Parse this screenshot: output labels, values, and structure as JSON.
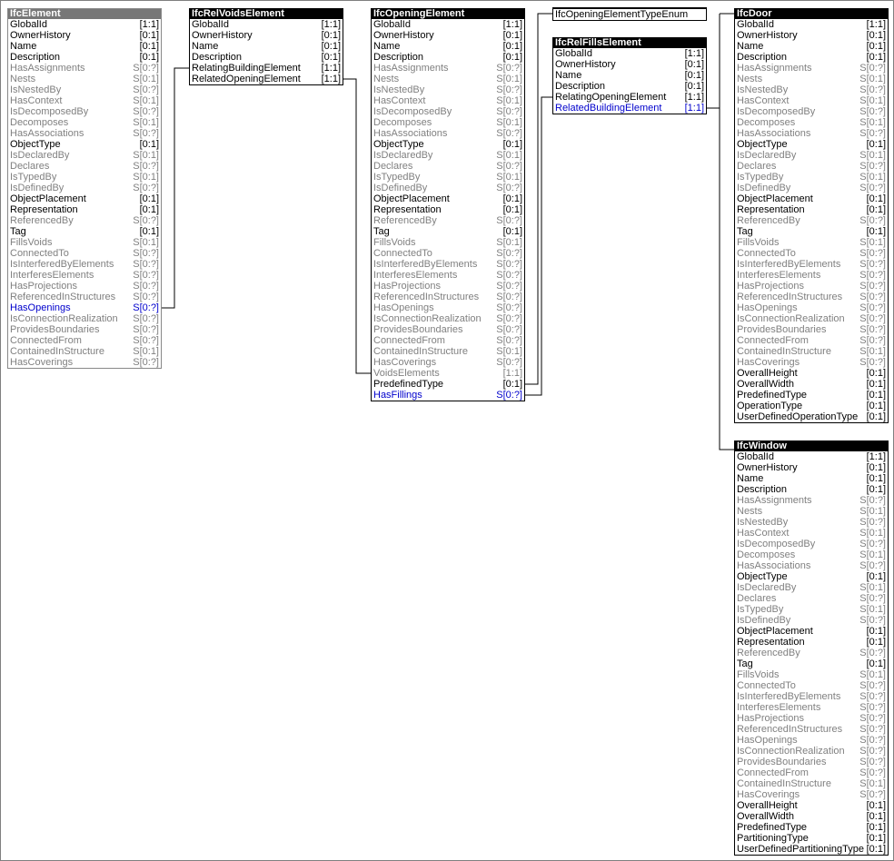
{
  "entities": [
    {
      "id": "IfcElement",
      "name": "IfcElement",
      "header": "gray",
      "rows": [
        [
          "GlobalId",
          "[1:1]",
          "n"
        ],
        [
          "OwnerHistory",
          "[0:1]",
          "n"
        ],
        [
          "Name",
          "[0:1]",
          "n"
        ],
        [
          "Description",
          "[0:1]",
          "n"
        ],
        [
          "HasAssignments",
          "S[0:?]",
          "i"
        ],
        [
          "Nests",
          "S[0:1]",
          "i"
        ],
        [
          "IsNestedBy",
          "S[0:?]",
          "i"
        ],
        [
          "HasContext",
          "S[0:1]",
          "i"
        ],
        [
          "IsDecomposedBy",
          "S[0:?]",
          "i"
        ],
        [
          "Decomposes",
          "S[0:1]",
          "i"
        ],
        [
          "HasAssociations",
          "S[0:?]",
          "i"
        ],
        [
          "ObjectType",
          "[0:1]",
          "n"
        ],
        [
          "IsDeclaredBy",
          "S[0:1]",
          "i"
        ],
        [
          "Declares",
          "S[0:?]",
          "i"
        ],
        [
          "IsTypedBy",
          "S[0:1]",
          "i"
        ],
        [
          "IsDefinedBy",
          "S[0:?]",
          "i"
        ],
        [
          "ObjectPlacement",
          "[0:1]",
          "n"
        ],
        [
          "Representation",
          "[0:1]",
          "n"
        ],
        [
          "ReferencedBy",
          "S[0:?]",
          "i"
        ],
        [
          "Tag",
          "[0:1]",
          "n"
        ],
        [
          "FillsVoids",
          "S[0:1]",
          "i"
        ],
        [
          "ConnectedTo",
          "S[0:?]",
          "i"
        ],
        [
          "IsInterferedByElements",
          "S[0:?]",
          "i"
        ],
        [
          "InterferesElements",
          "S[0:?]",
          "i"
        ],
        [
          "HasProjections",
          "S[0:?]",
          "i"
        ],
        [
          "ReferencedInStructures",
          "S[0:?]",
          "i"
        ],
        [
          "HasOpenings",
          "S[0:?]",
          "l"
        ],
        [
          "IsConnectionRealization",
          "S[0:?]",
          "i"
        ],
        [
          "ProvidesBoundaries",
          "S[0:?]",
          "i"
        ],
        [
          "ConnectedFrom",
          "S[0:?]",
          "i"
        ],
        [
          "ContainedInStructure",
          "S[0:1]",
          "i"
        ],
        [
          "HasCoverings",
          "S[0:?]",
          "i"
        ]
      ]
    },
    {
      "id": "IfcRelVoidsElement",
      "name": "IfcRelVoidsElement",
      "header": "black",
      "rows": [
        [
          "GlobalId",
          "[1:1]",
          "n"
        ],
        [
          "OwnerHistory",
          "[0:1]",
          "n"
        ],
        [
          "Name",
          "[0:1]",
          "n"
        ],
        [
          "Description",
          "[0:1]",
          "n"
        ],
        [
          "RelatingBuildingElement",
          "[1:1]",
          "n"
        ],
        [
          "RelatedOpeningElement",
          "[1:1]",
          "n"
        ]
      ]
    },
    {
      "id": "IfcOpeningElement",
      "name": "IfcOpeningElement",
      "header": "black",
      "rows": [
        [
          "GlobalId",
          "[1:1]",
          "n"
        ],
        [
          "OwnerHistory",
          "[0:1]",
          "n"
        ],
        [
          "Name",
          "[0:1]",
          "n"
        ],
        [
          "Description",
          "[0:1]",
          "n"
        ],
        [
          "HasAssignments",
          "S[0:?]",
          "i"
        ],
        [
          "Nests",
          "S[0:1]",
          "i"
        ],
        [
          "IsNestedBy",
          "S[0:?]",
          "i"
        ],
        [
          "HasContext",
          "S[0:1]",
          "i"
        ],
        [
          "IsDecomposedBy",
          "S[0:?]",
          "i"
        ],
        [
          "Decomposes",
          "S[0:1]",
          "i"
        ],
        [
          "HasAssociations",
          "S[0:?]",
          "i"
        ],
        [
          "ObjectType",
          "[0:1]",
          "n"
        ],
        [
          "IsDeclaredBy",
          "S[0:1]",
          "i"
        ],
        [
          "Declares",
          "S[0:?]",
          "i"
        ],
        [
          "IsTypedBy",
          "S[0:1]",
          "i"
        ],
        [
          "IsDefinedBy",
          "S[0:?]",
          "i"
        ],
        [
          "ObjectPlacement",
          "[0:1]",
          "n"
        ],
        [
          "Representation",
          "[0:1]",
          "n"
        ],
        [
          "ReferencedBy",
          "S[0:?]",
          "i"
        ],
        [
          "Tag",
          "[0:1]",
          "n"
        ],
        [
          "FillsVoids",
          "S[0:1]",
          "i"
        ],
        [
          "ConnectedTo",
          "S[0:?]",
          "i"
        ],
        [
          "IsInterferedByElements",
          "S[0:?]",
          "i"
        ],
        [
          "InterferesElements",
          "S[0:?]",
          "i"
        ],
        [
          "HasProjections",
          "S[0:?]",
          "i"
        ],
        [
          "ReferencedInStructures",
          "S[0:?]",
          "i"
        ],
        [
          "HasOpenings",
          "S[0:?]",
          "i"
        ],
        [
          "IsConnectionRealization",
          "S[0:?]",
          "i"
        ],
        [
          "ProvidesBoundaries",
          "S[0:?]",
          "i"
        ],
        [
          "ConnectedFrom",
          "S[0:?]",
          "i"
        ],
        [
          "ContainedInStructure",
          "S[0:1]",
          "i"
        ],
        [
          "HasCoverings",
          "S[0:?]",
          "i"
        ],
        [
          "VoidsElements",
          "[1:1]",
          "i"
        ],
        [
          "PredefinedType",
          "[0:1]",
          "n"
        ],
        [
          "HasFillings",
          "S[0:?]",
          "l"
        ]
      ]
    },
    {
      "id": "IfcRelFillsElement",
      "name": "IfcRelFillsElement",
      "header": "black",
      "rows": [
        [
          "GlobalId",
          "[1:1]",
          "n"
        ],
        [
          "OwnerHistory",
          "[0:1]",
          "n"
        ],
        [
          "Name",
          "[0:1]",
          "n"
        ],
        [
          "Description",
          "[0:1]",
          "n"
        ],
        [
          "RelatingOpeningElement",
          "[1:1]",
          "n"
        ],
        [
          "RelatedBuildingElement",
          "[1:1]",
          "l"
        ]
      ]
    },
    {
      "id": "IfcDoor",
      "name": "IfcDoor",
      "header": "black",
      "rows": [
        [
          "GlobalId",
          "[1:1]",
          "n"
        ],
        [
          "OwnerHistory",
          "[0:1]",
          "n"
        ],
        [
          "Name",
          "[0:1]",
          "n"
        ],
        [
          "Description",
          "[0:1]",
          "n"
        ],
        [
          "HasAssignments",
          "S[0:?]",
          "i"
        ],
        [
          "Nests",
          "S[0:1]",
          "i"
        ],
        [
          "IsNestedBy",
          "S[0:?]",
          "i"
        ],
        [
          "HasContext",
          "S[0:1]",
          "i"
        ],
        [
          "IsDecomposedBy",
          "S[0:?]",
          "i"
        ],
        [
          "Decomposes",
          "S[0:1]",
          "i"
        ],
        [
          "HasAssociations",
          "S[0:?]",
          "i"
        ],
        [
          "ObjectType",
          "[0:1]",
          "n"
        ],
        [
          "IsDeclaredBy",
          "S[0:1]",
          "i"
        ],
        [
          "Declares",
          "S[0:?]",
          "i"
        ],
        [
          "IsTypedBy",
          "S[0:1]",
          "i"
        ],
        [
          "IsDefinedBy",
          "S[0:?]",
          "i"
        ],
        [
          "ObjectPlacement",
          "[0:1]",
          "n"
        ],
        [
          "Representation",
          "[0:1]",
          "n"
        ],
        [
          "ReferencedBy",
          "S[0:?]",
          "i"
        ],
        [
          "Tag",
          "[0:1]",
          "n"
        ],
        [
          "FillsVoids",
          "S[0:1]",
          "i"
        ],
        [
          "ConnectedTo",
          "S[0:?]",
          "i"
        ],
        [
          "IsInterferedByElements",
          "S[0:?]",
          "i"
        ],
        [
          "InterferesElements",
          "S[0:?]",
          "i"
        ],
        [
          "HasProjections",
          "S[0:?]",
          "i"
        ],
        [
          "ReferencedInStructures",
          "S[0:?]",
          "i"
        ],
        [
          "HasOpenings",
          "S[0:?]",
          "i"
        ],
        [
          "IsConnectionRealization",
          "S[0:?]",
          "i"
        ],
        [
          "ProvidesBoundaries",
          "S[0:?]",
          "i"
        ],
        [
          "ConnectedFrom",
          "S[0:?]",
          "i"
        ],
        [
          "ContainedInStructure",
          "S[0:1]",
          "i"
        ],
        [
          "HasCoverings",
          "S[0:?]",
          "i"
        ],
        [
          "OverallHeight",
          "[0:1]",
          "n"
        ],
        [
          "OverallWidth",
          "[0:1]",
          "n"
        ],
        [
          "PredefinedType",
          "[0:1]",
          "n"
        ],
        [
          "OperationType",
          "[0:1]",
          "n"
        ],
        [
          "UserDefinedOperationType",
          "[0:1]",
          "n"
        ]
      ]
    },
    {
      "id": "IfcWindow",
      "name": "IfcWindow",
      "header": "black",
      "rows": [
        [
          "GlobalId",
          "[1:1]",
          "n"
        ],
        [
          "OwnerHistory",
          "[0:1]",
          "n"
        ],
        [
          "Name",
          "[0:1]",
          "n"
        ],
        [
          "Description",
          "[0:1]",
          "n"
        ],
        [
          "HasAssignments",
          "S[0:?]",
          "i"
        ],
        [
          "Nests",
          "S[0:1]",
          "i"
        ],
        [
          "IsNestedBy",
          "S[0:?]",
          "i"
        ],
        [
          "HasContext",
          "S[0:1]",
          "i"
        ],
        [
          "IsDecomposedBy",
          "S[0:?]",
          "i"
        ],
        [
          "Decomposes",
          "S[0:1]",
          "i"
        ],
        [
          "HasAssociations",
          "S[0:?]",
          "i"
        ],
        [
          "ObjectType",
          "[0:1]",
          "n"
        ],
        [
          "IsDeclaredBy",
          "S[0:1]",
          "i"
        ],
        [
          "Declares",
          "S[0:?]",
          "i"
        ],
        [
          "IsTypedBy",
          "S[0:1]",
          "i"
        ],
        [
          "IsDefinedBy",
          "S[0:?]",
          "i"
        ],
        [
          "ObjectPlacement",
          "[0:1]",
          "n"
        ],
        [
          "Representation",
          "[0:1]",
          "n"
        ],
        [
          "ReferencedBy",
          "S[0:?]",
          "i"
        ],
        [
          "Tag",
          "[0:1]",
          "n"
        ],
        [
          "FillsVoids",
          "S[0:1]",
          "i"
        ],
        [
          "ConnectedTo",
          "S[0:?]",
          "i"
        ],
        [
          "IsInterferedByElements",
          "S[0:?]",
          "i"
        ],
        [
          "InterferesElements",
          "S[0:?]",
          "i"
        ],
        [
          "HasProjections",
          "S[0:?]",
          "i"
        ],
        [
          "ReferencedInStructures",
          "S[0:?]",
          "i"
        ],
        [
          "HasOpenings",
          "S[0:?]",
          "i"
        ],
        [
          "IsConnectionRealization",
          "S[0:?]",
          "i"
        ],
        [
          "ProvidesBoundaries",
          "S[0:?]",
          "i"
        ],
        [
          "ConnectedFrom",
          "S[0:?]",
          "i"
        ],
        [
          "ContainedInStructure",
          "S[0:1]",
          "i"
        ],
        [
          "HasCoverings",
          "S[0:?]",
          "i"
        ],
        [
          "OverallHeight",
          "[0:1]",
          "n"
        ],
        [
          "OverallWidth",
          "[0:1]",
          "n"
        ],
        [
          "PredefinedType",
          "[0:1]",
          "n"
        ],
        [
          "PartitioningType",
          "[0:1]",
          "n"
        ],
        [
          "UserDefinedPartitioningType",
          "[0:1]",
          "n"
        ]
      ]
    }
  ],
  "enum_box": {
    "label": "IfcOpeningElementTypeEnum"
  },
  "colors": {
    "normal": "#000000",
    "inverse": "#808080",
    "link": "#0000cc",
    "gray_header": "#777777",
    "black_header": "#000000"
  }
}
